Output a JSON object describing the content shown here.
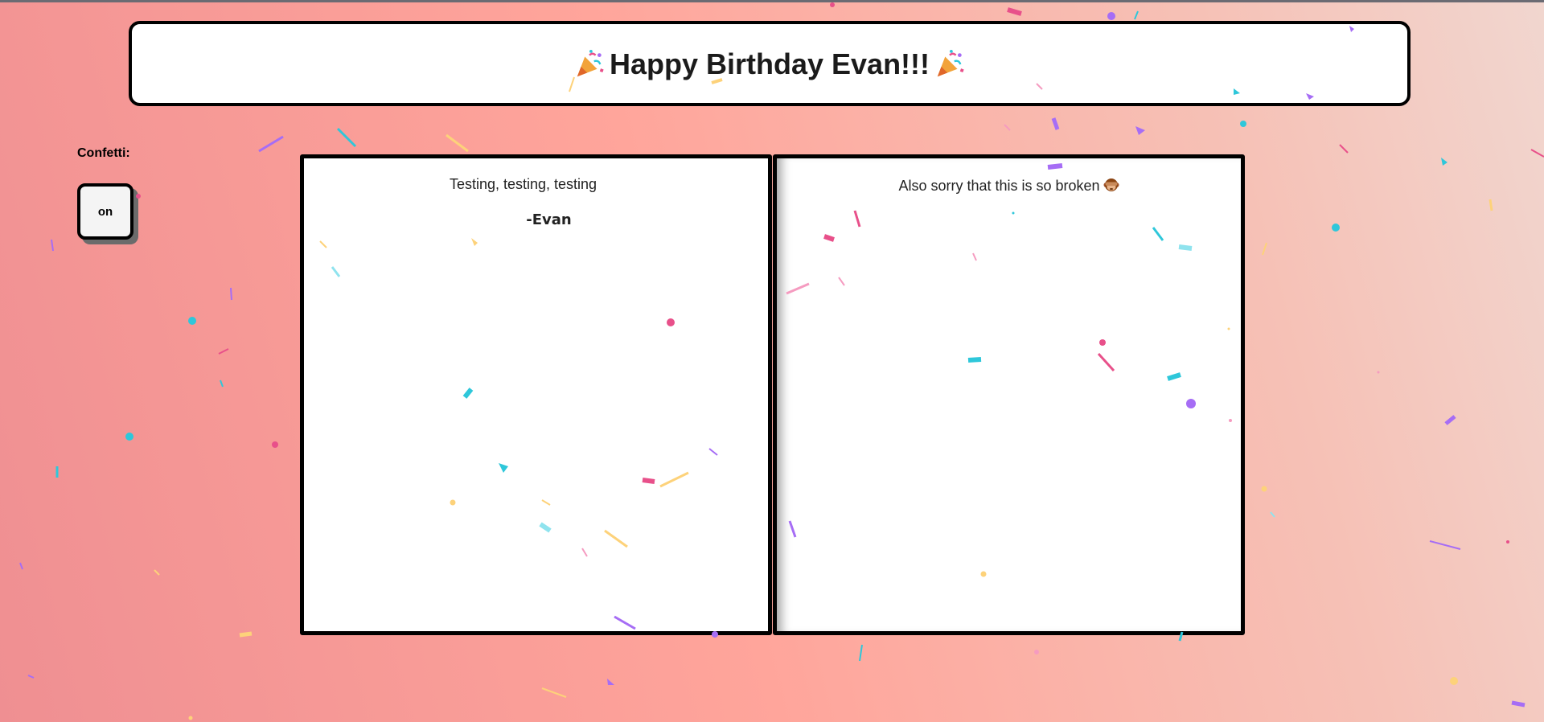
{
  "header": {
    "title": "Happy Birthday Evan!!!",
    "left_icon": "party-popper-icon",
    "right_icon": "party-popper-icon"
  },
  "controls": {
    "confetti_label": "Confetti:",
    "toggle_label": "on"
  },
  "cards": {
    "left": {
      "message": "Testing, testing, testing",
      "signature": "-Evan"
    },
    "right": {
      "message": "Also sorry that this is so broken",
      "icon": "see-no-evil-monkey-icon"
    }
  },
  "colors": {
    "background_start": "#ef8f92",
    "background_mid": "#ffa59b",
    "background_end": "#f1d6cf",
    "confetti": [
      "#e8508a",
      "#2ec7da",
      "#a66df5",
      "#fdd27a",
      "#f59bc0",
      "#8fe3ee"
    ]
  }
}
